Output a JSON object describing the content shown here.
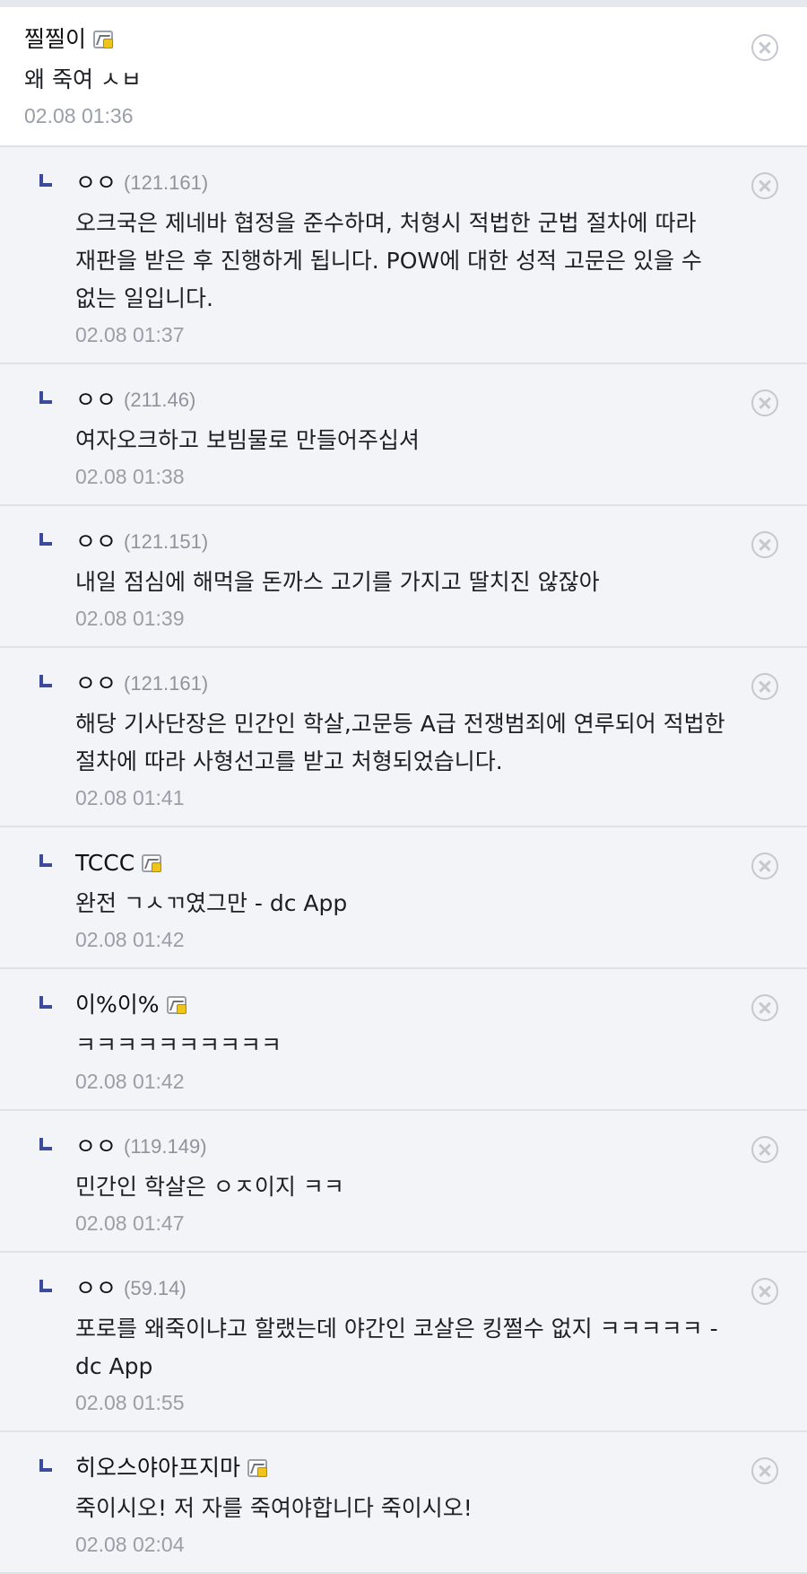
{
  "top_comment": {
    "author": "찔찔이",
    "text": "왜 죽여 ㅅㅂ",
    "date": "02.08 01:36",
    "badge_icon": "gallery-badge-icon"
  },
  "replies": [
    {
      "author": "ㅇㅇ",
      "ip": "(121.161)",
      "text": "오크국은 제네바 협정을 준수하며, 처형시 적법한 군법 절차에 따라 재판을 받은 후 진행하게 됩니다. POW에 대한 성적 고문은 있을 수 없는 일입니다.",
      "date": "02.08 01:37"
    },
    {
      "author": "ㅇㅇ",
      "ip": "(211.46)",
      "text": "여자오크하고 보빔물로 만들어주십셔",
      "date": "02.08 01:38"
    },
    {
      "author": "ㅇㅇ",
      "ip": "(121.151)",
      "text": "내일 점심에 해먹을 돈까스 고기를 가지고 딸치진 않잖아",
      "date": "02.08 01:39"
    },
    {
      "author": "ㅇㅇ",
      "ip": "(121.161)",
      "text": "해당 기사단장은 민간인 학살,고문등 A급 전쟁범죄에 연루되어 적법한 절차에 따라 사형선고를 받고 처형되었습니다.",
      "date": "02.08 01:41"
    },
    {
      "author": "TCCC",
      "ip": "",
      "text": "완전 ㄱㅅㄲ였그만 - dc App",
      "date": "02.08 01:42"
    },
    {
      "author": "이%이%",
      "ip": "",
      "text": "ㅋㅋㅋㅋㅋㅋㅋㅋㅋㅋ",
      "date": "02.08 01:42"
    },
    {
      "author": "ㅇㅇ",
      "ip": "(119.149)",
      "text": "민간인 학살은 ㅇㅈ이지 ㅋㅋ",
      "date": "02.08 01:47"
    },
    {
      "author": "ㅇㅇ",
      "ip": "(59.14)",
      "text": "포로를 왜죽이냐고 할랬는데 야간인 코살은 킹쩔수 없지 ㅋㅋㅋㅋㅋ - dc App",
      "date": "02.08 01:55"
    },
    {
      "author": "히오스야아프지마",
      "ip": "",
      "text": "죽이시오! 저 자를 죽여야합니다 죽이시오!",
      "date": "02.08 02:04"
    }
  ],
  "colors": {
    "reply_mark": "#3b4a9a",
    "background": "#f3f4f7",
    "date_text": "#9a9ea6"
  }
}
